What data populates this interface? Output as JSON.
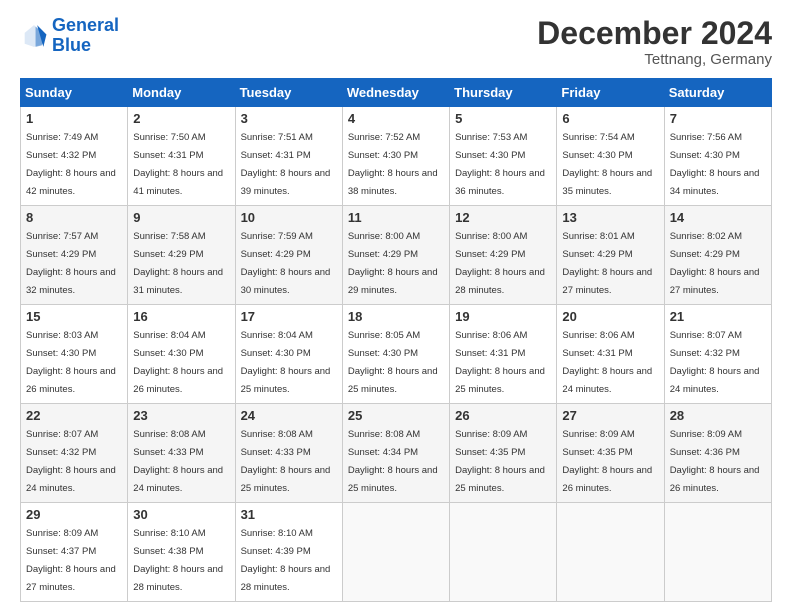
{
  "header": {
    "logo_line1": "General",
    "logo_line2": "Blue",
    "title": "December 2024",
    "subtitle": "Tettnang, Germany"
  },
  "weekdays": [
    "Sunday",
    "Monday",
    "Tuesday",
    "Wednesday",
    "Thursday",
    "Friday",
    "Saturday"
  ],
  "weeks": [
    [
      {
        "day": "1",
        "sunrise": "Sunrise: 7:49 AM",
        "sunset": "Sunset: 4:32 PM",
        "daylight": "Daylight: 8 hours and 42 minutes."
      },
      {
        "day": "2",
        "sunrise": "Sunrise: 7:50 AM",
        "sunset": "Sunset: 4:31 PM",
        "daylight": "Daylight: 8 hours and 41 minutes."
      },
      {
        "day": "3",
        "sunrise": "Sunrise: 7:51 AM",
        "sunset": "Sunset: 4:31 PM",
        "daylight": "Daylight: 8 hours and 39 minutes."
      },
      {
        "day": "4",
        "sunrise": "Sunrise: 7:52 AM",
        "sunset": "Sunset: 4:30 PM",
        "daylight": "Daylight: 8 hours and 38 minutes."
      },
      {
        "day": "5",
        "sunrise": "Sunrise: 7:53 AM",
        "sunset": "Sunset: 4:30 PM",
        "daylight": "Daylight: 8 hours and 36 minutes."
      },
      {
        "day": "6",
        "sunrise": "Sunrise: 7:54 AM",
        "sunset": "Sunset: 4:30 PM",
        "daylight": "Daylight: 8 hours and 35 minutes."
      },
      {
        "day": "7",
        "sunrise": "Sunrise: 7:56 AM",
        "sunset": "Sunset: 4:30 PM",
        "daylight": "Daylight: 8 hours and 34 minutes."
      }
    ],
    [
      {
        "day": "8",
        "sunrise": "Sunrise: 7:57 AM",
        "sunset": "Sunset: 4:29 PM",
        "daylight": "Daylight: 8 hours and 32 minutes."
      },
      {
        "day": "9",
        "sunrise": "Sunrise: 7:58 AM",
        "sunset": "Sunset: 4:29 PM",
        "daylight": "Daylight: 8 hours and 31 minutes."
      },
      {
        "day": "10",
        "sunrise": "Sunrise: 7:59 AM",
        "sunset": "Sunset: 4:29 PM",
        "daylight": "Daylight: 8 hours and 30 minutes."
      },
      {
        "day": "11",
        "sunrise": "Sunrise: 8:00 AM",
        "sunset": "Sunset: 4:29 PM",
        "daylight": "Daylight: 8 hours and 29 minutes."
      },
      {
        "day": "12",
        "sunrise": "Sunrise: 8:00 AM",
        "sunset": "Sunset: 4:29 PM",
        "daylight": "Daylight: 8 hours and 28 minutes."
      },
      {
        "day": "13",
        "sunrise": "Sunrise: 8:01 AM",
        "sunset": "Sunset: 4:29 PM",
        "daylight": "Daylight: 8 hours and 27 minutes."
      },
      {
        "day": "14",
        "sunrise": "Sunrise: 8:02 AM",
        "sunset": "Sunset: 4:29 PM",
        "daylight": "Daylight: 8 hours and 27 minutes."
      }
    ],
    [
      {
        "day": "15",
        "sunrise": "Sunrise: 8:03 AM",
        "sunset": "Sunset: 4:30 PM",
        "daylight": "Daylight: 8 hours and 26 minutes."
      },
      {
        "day": "16",
        "sunrise": "Sunrise: 8:04 AM",
        "sunset": "Sunset: 4:30 PM",
        "daylight": "Daylight: 8 hours and 26 minutes."
      },
      {
        "day": "17",
        "sunrise": "Sunrise: 8:04 AM",
        "sunset": "Sunset: 4:30 PM",
        "daylight": "Daylight: 8 hours and 25 minutes."
      },
      {
        "day": "18",
        "sunrise": "Sunrise: 8:05 AM",
        "sunset": "Sunset: 4:30 PM",
        "daylight": "Daylight: 8 hours and 25 minutes."
      },
      {
        "day": "19",
        "sunrise": "Sunrise: 8:06 AM",
        "sunset": "Sunset: 4:31 PM",
        "daylight": "Daylight: 8 hours and 25 minutes."
      },
      {
        "day": "20",
        "sunrise": "Sunrise: 8:06 AM",
        "sunset": "Sunset: 4:31 PM",
        "daylight": "Daylight: 8 hours and 24 minutes."
      },
      {
        "day": "21",
        "sunrise": "Sunrise: 8:07 AM",
        "sunset": "Sunset: 4:32 PM",
        "daylight": "Daylight: 8 hours and 24 minutes."
      }
    ],
    [
      {
        "day": "22",
        "sunrise": "Sunrise: 8:07 AM",
        "sunset": "Sunset: 4:32 PM",
        "daylight": "Daylight: 8 hours and 24 minutes."
      },
      {
        "day": "23",
        "sunrise": "Sunrise: 8:08 AM",
        "sunset": "Sunset: 4:33 PM",
        "daylight": "Daylight: 8 hours and 24 minutes."
      },
      {
        "day": "24",
        "sunrise": "Sunrise: 8:08 AM",
        "sunset": "Sunset: 4:33 PM",
        "daylight": "Daylight: 8 hours and 25 minutes."
      },
      {
        "day": "25",
        "sunrise": "Sunrise: 8:08 AM",
        "sunset": "Sunset: 4:34 PM",
        "daylight": "Daylight: 8 hours and 25 minutes."
      },
      {
        "day": "26",
        "sunrise": "Sunrise: 8:09 AM",
        "sunset": "Sunset: 4:35 PM",
        "daylight": "Daylight: 8 hours and 25 minutes."
      },
      {
        "day": "27",
        "sunrise": "Sunrise: 8:09 AM",
        "sunset": "Sunset: 4:35 PM",
        "daylight": "Daylight: 8 hours and 26 minutes."
      },
      {
        "day": "28",
        "sunrise": "Sunrise: 8:09 AM",
        "sunset": "Sunset: 4:36 PM",
        "daylight": "Daylight: 8 hours and 26 minutes."
      }
    ],
    [
      {
        "day": "29",
        "sunrise": "Sunrise: 8:09 AM",
        "sunset": "Sunset: 4:37 PM",
        "daylight": "Daylight: 8 hours and 27 minutes."
      },
      {
        "day": "30",
        "sunrise": "Sunrise: 8:10 AM",
        "sunset": "Sunset: 4:38 PM",
        "daylight": "Daylight: 8 hours and 28 minutes."
      },
      {
        "day": "31",
        "sunrise": "Sunrise: 8:10 AM",
        "sunset": "Sunset: 4:39 PM",
        "daylight": "Daylight: 8 hours and 28 minutes."
      },
      null,
      null,
      null,
      null
    ]
  ]
}
